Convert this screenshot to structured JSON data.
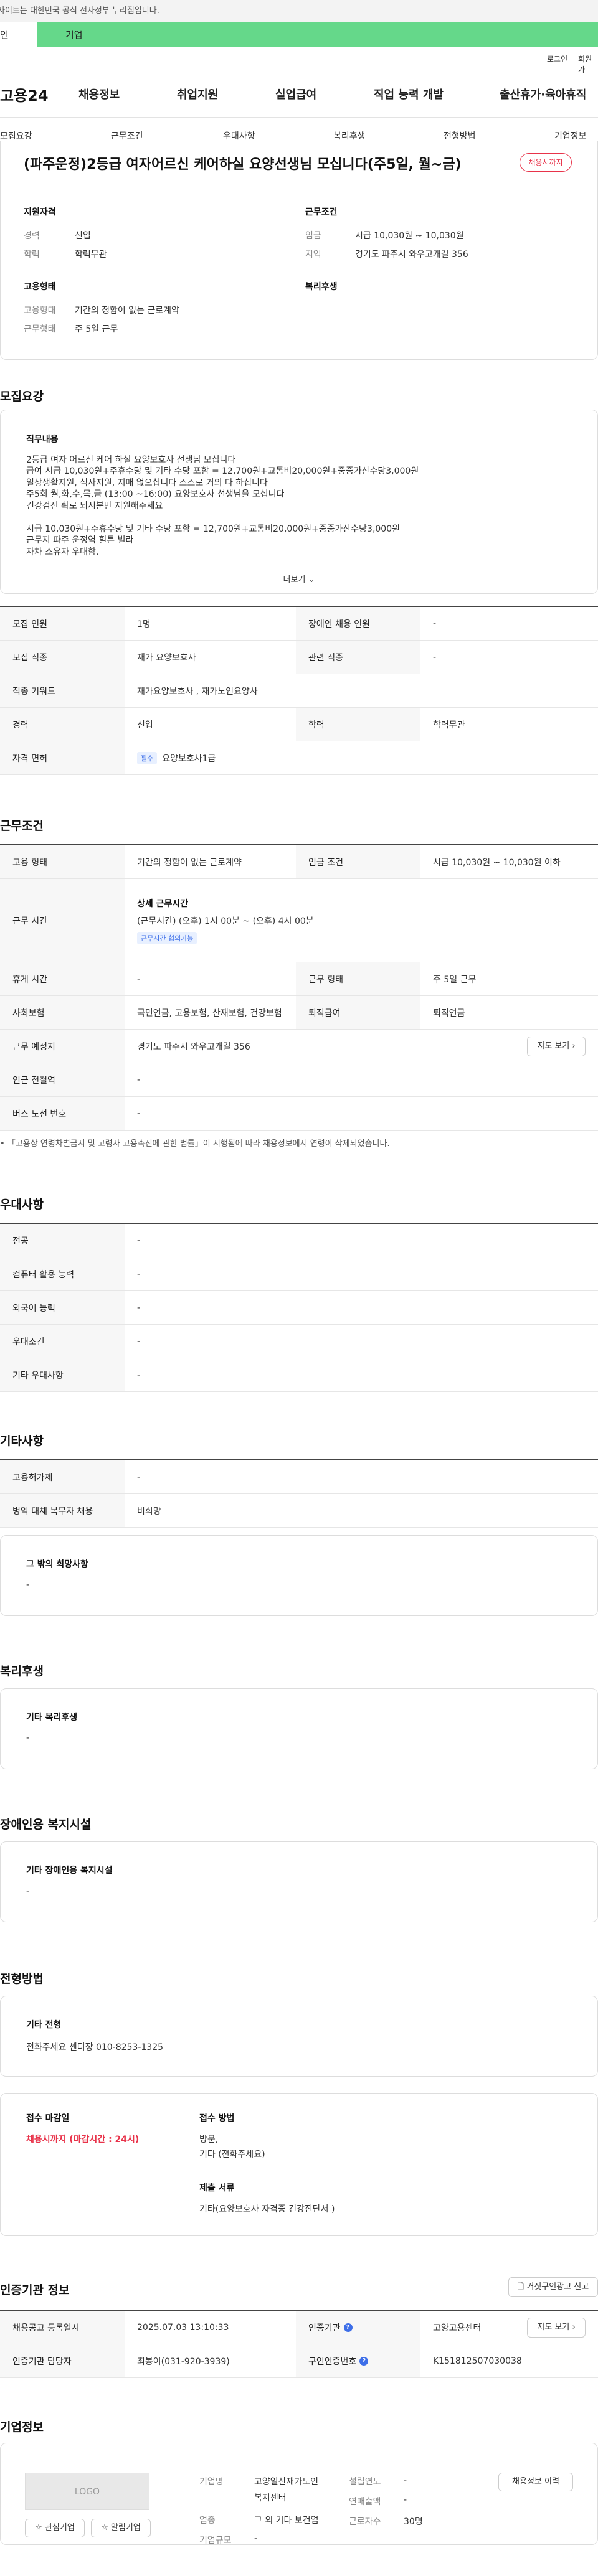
{
  "gov_notice": "사이트는 대한민국 공식 전자정부 누리집입니다.",
  "top_tabs": {
    "personal": "인",
    "corporate": "기업"
  },
  "util": {
    "login": "로그인",
    "signup": "회원가"
  },
  "logo": "고용24",
  "gnb": [
    "채용정보",
    "취업지원",
    "실업급여",
    "직업 능력 개발",
    "출산휴가·육아휴직"
  ],
  "anchors": [
    "모집요강",
    "근무조건",
    "우대사항",
    "복리후생",
    "전형방법",
    "기업정보"
  ],
  "job": {
    "title": "(파주운정)2등급 여자어르신 케어하실 요양선생님 모십니다(주5일, 월~금)",
    "badge": "채용시까지",
    "qual_heading": "지원자격",
    "career_label": "경력",
    "career": "신입",
    "edu_label": "학력",
    "edu": "학력무관",
    "cond_heading": "근무조건",
    "wage_label": "임금",
    "wage": "시급 10,030원 ~ 10,030원",
    "region_label": "지역",
    "region": "경기도 파주시 와우고개길 356",
    "emp_heading": "고용형태",
    "emptype_label": "고용형태",
    "emptype": "기간의 정함이 없는 근로계약",
    "worktype_label": "근무형태",
    "worktype": "주 5일 근무",
    "welfare_heading": "복리후생"
  },
  "recruit": {
    "heading": "모집요강",
    "duty_heading": "직무내용",
    "description": "2등급 여자 어르신 케어 하실 요양보호사 선생님 모십니다\n급여 시급 10,030원+주휴수당 및 기타 수당 포함 = 12,700원+교통비20,000원+중증가산수당3,000원\n일상생활지원, 식사지원, 지매 없으십니다 스스로 거의 다 하십니다\n주5회 월,화,수,목,금 (13:00 ~16:00) 요양보호사 선생님을 모십니다\n건강검진 확로 되시분만 지원해주세요\n\n시급 10,030원+주휴수당 및 기타 수당 포함 = 12,700원+교통비20,000원+중증가산수당3,000원\n근무지 파주 운정역 힐튼 빌라\n자차 소유자 우대함.",
    "more": "더보기",
    "rows": [
      {
        "l1": "모집 인원",
        "v1": "1명",
        "l2": "장애인 채용 인원",
        "v2": "-"
      },
      {
        "l1": "모집 직종",
        "v1": "재가 요양보호사",
        "l2": "관련 직종",
        "v2": "-"
      },
      {
        "l1": "직종 키워드",
        "v1": "재가요양보호사 , 재가노인요양사",
        "l2": "",
        "v2": ""
      },
      {
        "l1": "경력",
        "v1": "신입",
        "l2": "학력",
        "v2": "학력무관"
      },
      {
        "l1": "자격 면허",
        "v1": "요양보호사1급",
        "l2": "",
        "v2": ""
      }
    ],
    "license_tag": "필수"
  },
  "work": {
    "heading": "근무조건",
    "emp_label": "고용 형태",
    "emp": "기간의 정함이 없는 근로계약",
    "wage_label": "임금 조건",
    "wage": "시급 10,030원 ~ 10,030원 이하",
    "time_label": "근무 시간",
    "time_heading": "상세 근무시간",
    "time": "(근무시간) (오후) 1시 00분 ~ (오후) 4시 00분",
    "time_tag": "근무시간 협의가능",
    "rest_label": "휴게 시간",
    "rest": "-",
    "worktype_label": "근무 형태",
    "worktype": "주 5일 근무",
    "insurance_label": "사회보험",
    "insurance": "국민연금, 고용보험, 산재보험, 건강보험",
    "retire_label": "퇴직급여",
    "retire": "퇴직연금",
    "place_label": "근무 예정지",
    "place": "경기도 파주시 와우고개길 356",
    "map_btn": "지도 보기",
    "subway_label": "인근 전철역",
    "subway": "-",
    "bus_label": "버스 노선 번호",
    "bus": "-",
    "note": "「고용상 연령차별금지 및 고령자 고용촉진에 관한 법률」이 시행됨에 따라 채용정보에서 연령이 삭제되었습니다."
  },
  "pref": {
    "heading": "우대사항",
    "rows": [
      {
        "l": "전공",
        "v": "-"
      },
      {
        "l": "컴퓨터 활용 능력",
        "v": "-"
      },
      {
        "l": "외국어 능력",
        "v": "-"
      },
      {
        "l": "우대조건",
        "v": "-"
      },
      {
        "l": "기타 우대사항",
        "v": "-"
      }
    ]
  },
  "etc": {
    "heading": "기타사항",
    "rows": [
      {
        "l": "고용허가제",
        "v": "-"
      },
      {
        "l": "병역 대체 복무자 채용",
        "v": "비희망"
      }
    ],
    "other_heading": "그 밖의 희망사항",
    "other": "-"
  },
  "welfare": {
    "heading": "복리후생",
    "box_heading": "기타 복리후생",
    "box": "-"
  },
  "disability": {
    "heading": "장애인용 복지시설",
    "box_heading": "기타 장애인용 복지시설",
    "box": "-"
  },
  "selection": {
    "heading": "전형방법",
    "box_heading": "기타 전형",
    "box": "전화주세요 센터장 010-8253-1325",
    "deadline_heading": "접수 마감일",
    "deadline": "채용시까지 (마감시간 : 24시)",
    "method_heading": "접수 방법",
    "method1": "방문,",
    "method2": "기타 (전화주세요)",
    "docs_heading": "제출 서류",
    "docs": "기타(요양보호사 자격증 건강진단서 )"
  },
  "auth": {
    "heading": "인증기관 정보",
    "report_btn": "거짓구인광고 신고",
    "reg_label": "채용공고 등록일시",
    "reg": "2025.07.03 13:10:33",
    "org_label": "인증기관",
    "org": "고양고용센터",
    "map_btn": "지도 보기",
    "mgr_label": "인증기관 담당자",
    "mgr": "최봉이(031-920-3939)",
    "no_label": "구인인증번호",
    "no": "K151812507030038"
  },
  "company": {
    "heading": "기업정보",
    "logo": "LOGO",
    "fav_btn": "관심기업",
    "follow_btn": "알림기업",
    "name_label": "기업명",
    "name1": "고양일산재가노인",
    "name2": "복지센터",
    "ind_label": "업종",
    "ind": "그 외 기타 보건업",
    "size_label": "기업규모",
    "size": "-",
    "est_label": "설립연도",
    "est": "-",
    "sales_label": "연매출액",
    "sales": "-",
    "emp_label": "근로자수",
    "emp": "30명",
    "history_btn": "채용정보 이력"
  }
}
